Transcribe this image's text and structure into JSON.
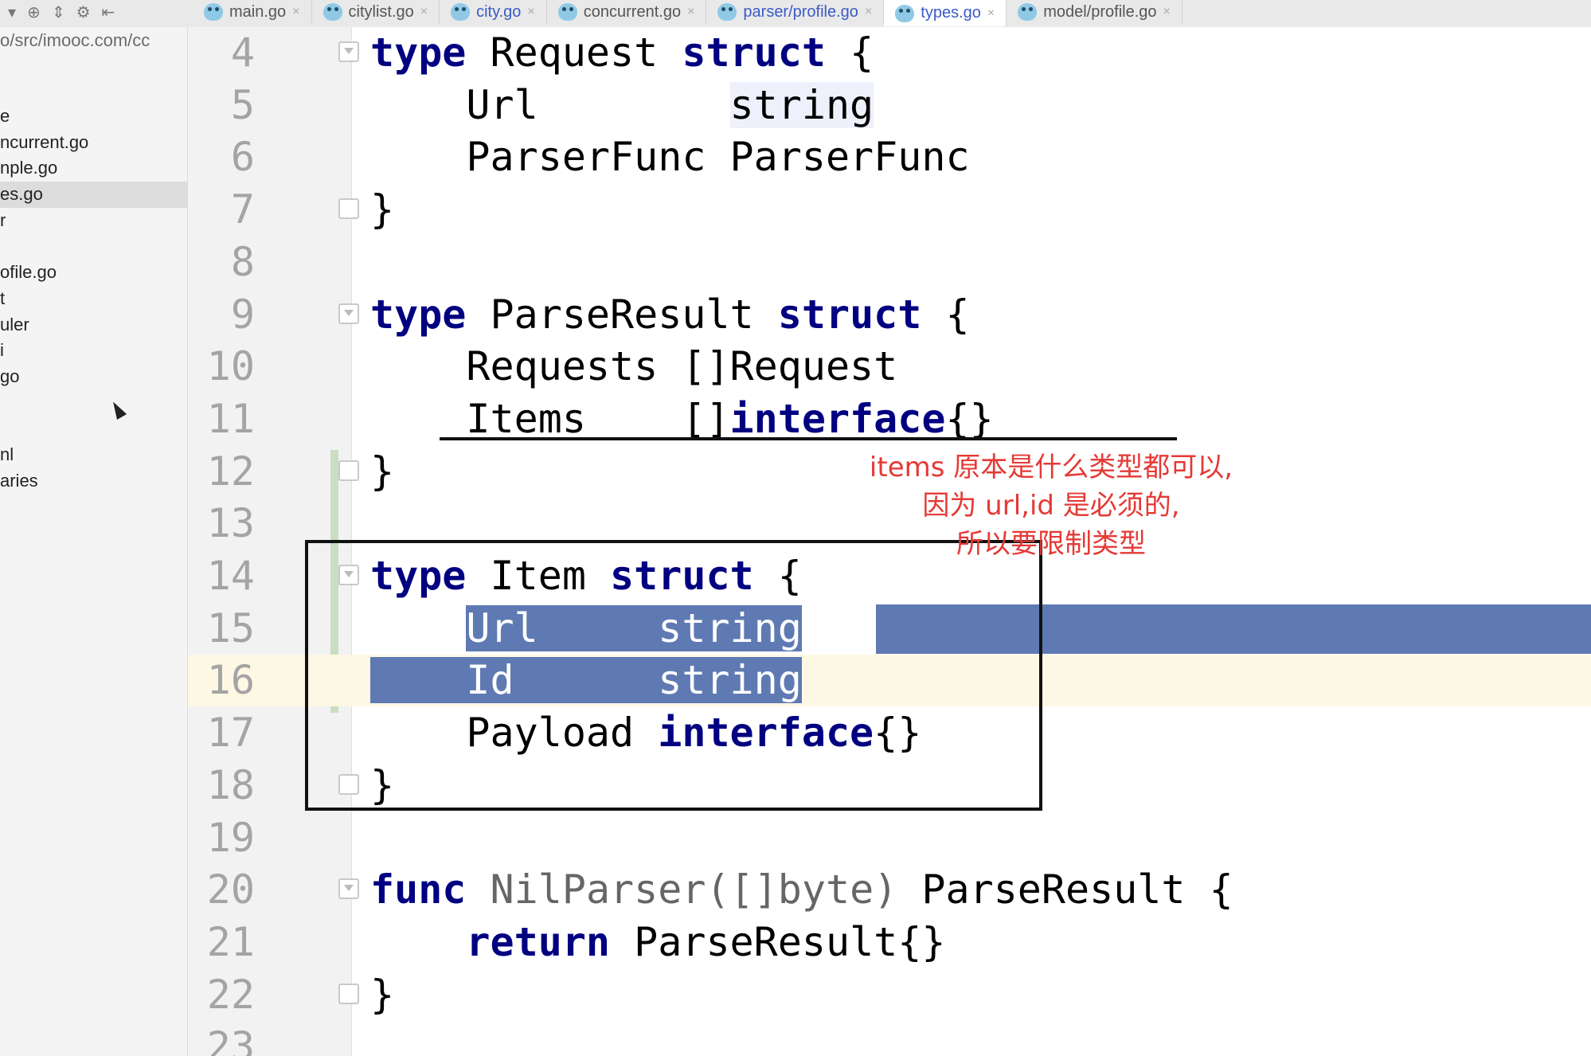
{
  "toolbar": {
    "icons": [
      "dropdown-arrow-icon",
      "target-icon",
      "collapse-icon",
      "gear-icon",
      "hide-panel-icon"
    ]
  },
  "tabs": [
    {
      "label": "main.go",
      "active": false,
      "blue": false
    },
    {
      "label": "citylist.go",
      "active": false,
      "blue": false
    },
    {
      "label": "city.go",
      "active": false,
      "blue": true
    },
    {
      "label": "concurrent.go",
      "active": false,
      "blue": false
    },
    {
      "label": "parser/profile.go",
      "active": false,
      "blue": true
    },
    {
      "label": "types.go",
      "active": true,
      "blue": true
    },
    {
      "label": "model/profile.go",
      "active": false,
      "blue": false
    }
  ],
  "sidebar": {
    "path": "o/src/imooc.com/cc",
    "items": [
      "e",
      "ncurrent.go",
      "nple.go",
      "es.go",
      "r",
      "",
      "ofile.go",
      "t",
      "uler",
      "i",
      "go",
      "",
      "",
      "nl",
      "aries"
    ],
    "selected_index": 3
  },
  "editor": {
    "current_line": 16,
    "lines": [
      {
        "n": "4",
        "html": "<span class=\"kw\">type</span> Request <span class=\"kw\">struct</span> {",
        "fold": "open"
      },
      {
        "n": "5",
        "html": "    Url        <span class=\"hl-string\">string</span>",
        "fold": ""
      },
      {
        "n": "6",
        "html": "    ParserFunc ParserFunc",
        "fold": ""
      },
      {
        "n": "7",
        "html": "}",
        "fold": "close"
      },
      {
        "n": "8",
        "html": "",
        "fold": ""
      },
      {
        "n": "9",
        "html": "<span class=\"kw\">type</span> ParseResult <span class=\"kw\">struct</span> {",
        "fold": "open"
      },
      {
        "n": "10",
        "html": "    Requests []Request",
        "fold": ""
      },
      {
        "n": "11",
        "html": "    Items    []<span class=\"kw\">interface</span>{}",
        "fold": ""
      },
      {
        "n": "12",
        "html": "}",
        "fold": "close"
      },
      {
        "n": "13",
        "html": "",
        "fold": ""
      },
      {
        "n": "14",
        "html": "<span class=\"kw\">type</span> Item <span class=\"kw\">struct</span> {",
        "fold": "open"
      },
      {
        "n": "15",
        "html": "    <span class=\"sel\">Url     string</span>",
        "fold": ""
      },
      {
        "n": "16",
        "html": "<span class=\"sel\">    Id      string</span>",
        "fold": ""
      },
      {
        "n": "17",
        "html": "    Payload <span class=\"kw\">interface</span>{}",
        "fold": ""
      },
      {
        "n": "18",
        "html": "}",
        "fold": "close"
      },
      {
        "n": "19",
        "html": "",
        "fold": ""
      },
      {
        "n": "20",
        "html": "<span class=\"kw\">func</span> <span class=\"dim\">NilParser([]byte)</span> ParseResult {",
        "fold": "open"
      },
      {
        "n": "21",
        "html": "    <span class=\"kw\">return</span> ParseResult{}",
        "fold": ""
      },
      {
        "n": "22",
        "html": "}",
        "fold": "close"
      },
      {
        "n": "23",
        "html": "",
        "fold": ""
      }
    ]
  },
  "annotation": {
    "lines": [
      "items 原本是什么类型都可以,",
      "因为 url,id 是必须的,",
      "所以要限制类型"
    ],
    "color": "#e53935"
  },
  "colors": {
    "keyword": "#000080",
    "selection": "#5f7ab3",
    "current_line": "#fdf8e4",
    "gutter": "#f2f2f2"
  }
}
